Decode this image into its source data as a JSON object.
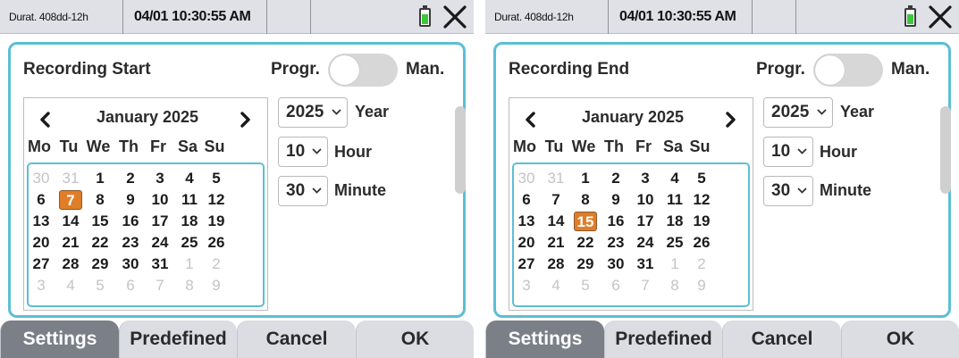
{
  "screens": [
    {
      "status": {
        "duration": "Durat. 408dd-12h",
        "datetime": "04/01 10:30:55 AM"
      },
      "title": "Recording Start",
      "mode": {
        "left_label": "Progr.",
        "right_label": "Man."
      },
      "calendar": {
        "month": "January 2025",
        "weekdays": [
          "Mo",
          "Tu",
          "We",
          "Th",
          "Fr",
          "Sa",
          "Su"
        ],
        "weeks": [
          [
            "30",
            "31",
            "1",
            "2",
            "3",
            "4",
            "5"
          ],
          [
            "6",
            "7",
            "8",
            "9",
            "10",
            "11",
            "12"
          ],
          [
            "13",
            "14",
            "15",
            "16",
            "17",
            "18",
            "19"
          ],
          [
            "20",
            "21",
            "22",
            "23",
            "24",
            "25",
            "26"
          ],
          [
            "27",
            "28",
            "29",
            "30",
            "31",
            "1",
            "2"
          ],
          [
            "3",
            "4",
            "5",
            "6",
            "7",
            "8",
            "9"
          ]
        ],
        "selected_day": "7"
      },
      "year": {
        "value": "2025",
        "label": "Year"
      },
      "hour": {
        "value": "10",
        "label": "Hour"
      },
      "minute": {
        "value": "30",
        "label": "Minute"
      },
      "buttons": {
        "settings": "Settings",
        "predefined": "Predefined",
        "cancel": "Cancel",
        "ok": "OK"
      },
      "active_button": "settings"
    },
    {
      "status": {
        "duration": "Durat. 408dd-12h",
        "datetime": "04/01 10:30:55 AM"
      },
      "title": "Recording End",
      "mode": {
        "left_label": "Progr.",
        "right_label": "Man."
      },
      "calendar": {
        "month": "January 2025",
        "weekdays": [
          "Mo",
          "Tu",
          "We",
          "Th",
          "Fr",
          "Sa",
          "Su"
        ],
        "weeks": [
          [
            "30",
            "31",
            "1",
            "2",
            "3",
            "4",
            "5"
          ],
          [
            "6",
            "7",
            "8",
            "9",
            "10",
            "11",
            "12"
          ],
          [
            "13",
            "14",
            "15",
            "16",
            "17",
            "18",
            "19"
          ],
          [
            "20",
            "21",
            "22",
            "23",
            "24",
            "25",
            "26"
          ],
          [
            "27",
            "28",
            "29",
            "30",
            "31",
            "1",
            "2"
          ],
          [
            "3",
            "4",
            "5",
            "6",
            "7",
            "8",
            "9"
          ]
        ],
        "selected_day": "15"
      },
      "year": {
        "value": "2025",
        "label": "Year"
      },
      "hour": {
        "value": "10",
        "label": "Hour"
      },
      "minute": {
        "value": "30",
        "label": "Minute"
      },
      "buttons": {
        "settings": "Settings",
        "predefined": "Predefined",
        "cancel": "Cancel",
        "ok": "OK"
      },
      "active_button": "settings"
    }
  ],
  "colors": {
    "accent": "#5bbfd4",
    "selected_day": "#e07d28",
    "battery": "#3cc83c",
    "active_button": "#7b7f87",
    "status_bar": "#dfe1e6"
  },
  "icons": {
    "battery": "battery-icon",
    "close": "close-icon",
    "prev_month": "chevron-left-icon",
    "next_month": "chevron-right-icon",
    "dropdown": "chevron-down-icon"
  },
  "battery_level": 0.7
}
